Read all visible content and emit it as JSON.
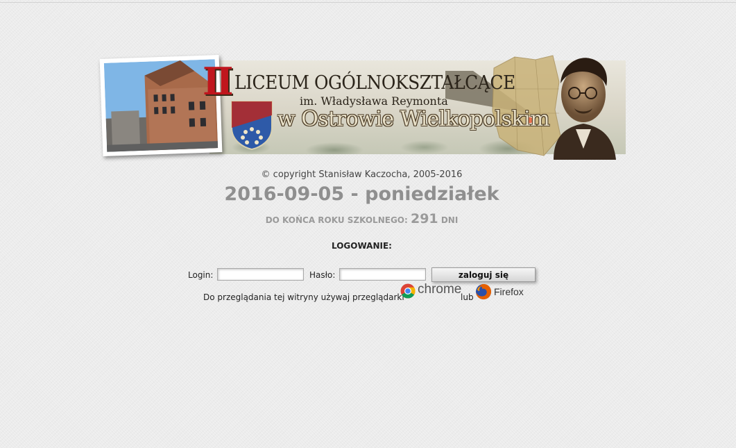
{
  "banner": {
    "roman_numeral": "II",
    "line1": "LICEUM OGÓLNOKSZTAŁCĄCE",
    "line2": "im. Władysława Reymonta",
    "line3": "w Ostrowie Wielkopolskim"
  },
  "copyright": "© copyright Stanisław Kaczocha, 2005-2016",
  "date_line": "2016-09-05 - poniedziałek",
  "countdown": {
    "prefix": "DO KOŃCA ROKU SZKOLNEGO:",
    "days": "291",
    "suffix": "DNI"
  },
  "login": {
    "heading": "LOGOWANIE:",
    "login_label": "Login:",
    "login_value": "",
    "password_label": "Hasło:",
    "password_value": "",
    "submit_label": "zaloguj się"
  },
  "browsers": {
    "text": "Do przeglądania tej witryny używaj przeglądarki",
    "chrome_label": "chrome",
    "or_text": "lub",
    "firefox_label": "Firefox",
    "chrome_icon": "chrome-icon",
    "firefox_icon": "firefox-icon"
  },
  "colors": {
    "background": "#ececec",
    "date_gray": "#8f8f8f",
    "roman_red": "#c0161d"
  }
}
